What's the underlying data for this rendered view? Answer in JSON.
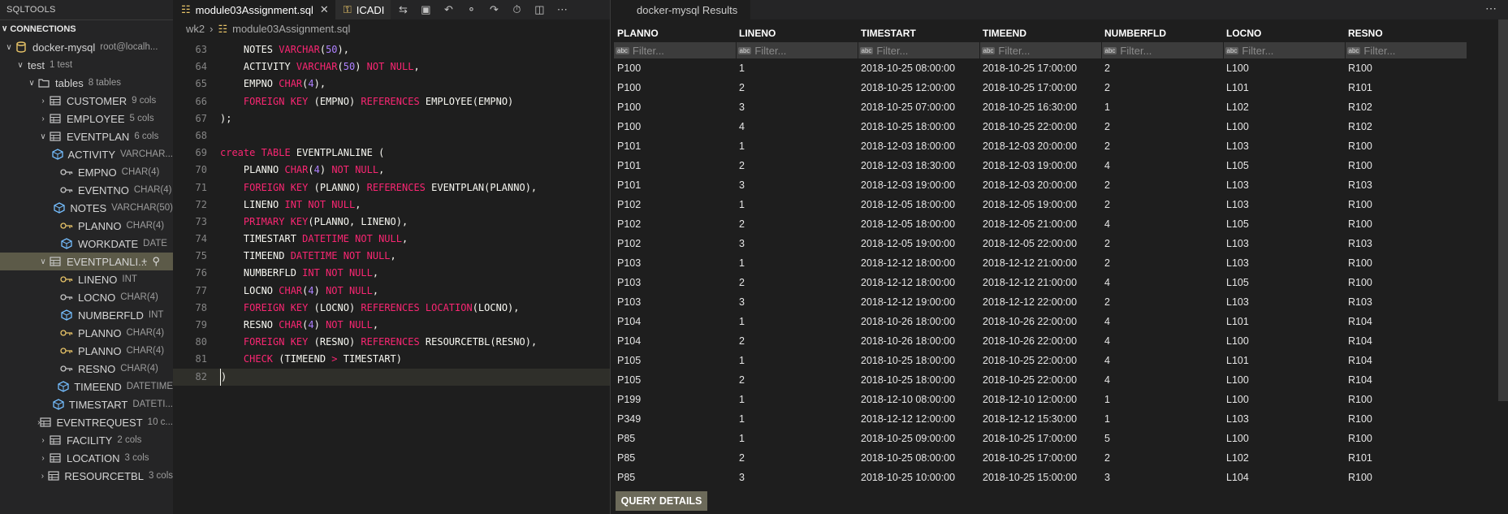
{
  "sidebar": {
    "title": "SQLTOOLS",
    "connections_label": "CONNECTIONS",
    "tree": [
      {
        "label": "docker-mysql",
        "desc": "root@localh...",
        "indent": 0,
        "chev": "∨",
        "icon": "db-icon"
      },
      {
        "label": "test",
        "desc": "1 test",
        "indent": 1,
        "chev": "∨",
        "icon": ""
      },
      {
        "label": "tables",
        "desc": "8 tables",
        "indent": 2,
        "chev": "∨",
        "icon": "folder-icon"
      },
      {
        "label": "CUSTOMER",
        "desc": "9 cols",
        "indent": 3,
        "chev": "›",
        "icon": "table-icon"
      },
      {
        "label": "EMPLOYEE",
        "desc": "5 cols",
        "indent": 3,
        "chev": "›",
        "icon": "table-icon"
      },
      {
        "label": "EVENTPLAN",
        "desc": "6 cols",
        "indent": 3,
        "chev": "∨",
        "icon": "table-icon"
      },
      {
        "label": "ACTIVITY",
        "desc": "VARCHAR...",
        "indent": 4,
        "chev": "",
        "icon": "column-icon"
      },
      {
        "label": "EMPNO",
        "desc": "CHAR(4)",
        "indent": 4,
        "chev": "",
        "icon": "key-icon"
      },
      {
        "label": "EVENTNO",
        "desc": "CHAR(4)",
        "indent": 4,
        "chev": "",
        "icon": "key-icon"
      },
      {
        "label": "NOTES",
        "desc": "VARCHAR(50)",
        "indent": 4,
        "chev": "",
        "icon": "column-icon"
      },
      {
        "label": "PLANNO",
        "desc": "CHAR(4)",
        "indent": 4,
        "chev": "",
        "icon": "pk-icon"
      },
      {
        "label": "WORKDATE",
        "desc": "DATE",
        "indent": 4,
        "chev": "",
        "icon": "column-icon"
      },
      {
        "label": "EVENTPLANLI...",
        "desc": "",
        "indent": 3,
        "chev": "∨",
        "icon": "table-icon",
        "selected": true
      },
      {
        "label": "LINENO",
        "desc": "INT",
        "indent": 4,
        "chev": "",
        "icon": "pk-icon"
      },
      {
        "label": "LOCNO",
        "desc": "CHAR(4)",
        "indent": 4,
        "chev": "",
        "icon": "key-icon"
      },
      {
        "label": "NUMBERFLD",
        "desc": "INT",
        "indent": 4,
        "chev": "",
        "icon": "column-icon"
      },
      {
        "label": "PLANNO",
        "desc": "CHAR(4)",
        "indent": 4,
        "chev": "",
        "icon": "pk-icon"
      },
      {
        "label": "PLANNO",
        "desc": "CHAR(4)",
        "indent": 4,
        "chev": "",
        "icon": "pk-icon"
      },
      {
        "label": "RESNO",
        "desc": "CHAR(4)",
        "indent": 4,
        "chev": "",
        "icon": "key-icon"
      },
      {
        "label": "TIMEEND",
        "desc": "DATETIME",
        "indent": 4,
        "chev": "",
        "icon": "column-icon"
      },
      {
        "label": "TIMESTART",
        "desc": "DATETI...",
        "indent": 4,
        "chev": "",
        "icon": "column-icon"
      },
      {
        "label": "EVENTREQUEST",
        "desc": "10 c...",
        "indent": 3,
        "chev": "›",
        "icon": "table-icon"
      },
      {
        "label": "FACILITY",
        "desc": "2 cols",
        "indent": 3,
        "chev": "›",
        "icon": "table-icon"
      },
      {
        "label": "LOCATION",
        "desc": "3 cols",
        "indent": 3,
        "chev": "›",
        "icon": "table-icon"
      },
      {
        "label": "RESOURCETBL",
        "desc": "3 cols",
        "indent": 3,
        "chev": "›",
        "icon": "table-icon"
      }
    ]
  },
  "editor": {
    "tab_active": "module03Assignment.sql",
    "tab_inactive": "ICADI",
    "breadcrumb": [
      "wk2",
      "module03Assignment.sql"
    ],
    "lines": [
      {
        "n": "63",
        "tokens": [
          [
            "id",
            "    NOTES "
          ],
          [
            "kw",
            "VARCHAR"
          ],
          [
            "id",
            "("
          ],
          [
            "num",
            "50"
          ],
          [
            "id",
            "),"
          ]
        ]
      },
      {
        "n": "64",
        "tokens": [
          [
            "id",
            "    ACTIVITY "
          ],
          [
            "kw",
            "VARCHAR"
          ],
          [
            "id",
            "("
          ],
          [
            "num",
            "50"
          ],
          [
            "id",
            ") "
          ],
          [
            "kw",
            "NOT NULL"
          ],
          [
            "id",
            ","
          ]
        ]
      },
      {
        "n": "65",
        "tokens": [
          [
            "id",
            "    EMPNO "
          ],
          [
            "kw",
            "CHAR"
          ],
          [
            "id",
            "("
          ],
          [
            "num",
            "4"
          ],
          [
            "id",
            "),"
          ]
        ]
      },
      {
        "n": "66",
        "tokens": [
          [
            "id",
            "    "
          ],
          [
            "kw",
            "FOREIGN KEY"
          ],
          [
            "id",
            " (EMPNO) "
          ],
          [
            "kw",
            "REFERENCES"
          ],
          [
            "id",
            " EMPLOYEE(EMPNO)"
          ]
        ]
      },
      {
        "n": "67",
        "tokens": [
          [
            "id",
            ");"
          ]
        ]
      },
      {
        "n": "68",
        "tokens": [
          [
            "id",
            ""
          ]
        ]
      },
      {
        "n": "69",
        "tokens": [
          [
            "kw",
            "create TABLE"
          ],
          [
            "id",
            " EVENTPLANLINE ("
          ]
        ]
      },
      {
        "n": "70",
        "tokens": [
          [
            "id",
            "    PLANNO "
          ],
          [
            "kw",
            "CHAR"
          ],
          [
            "id",
            "("
          ],
          [
            "num",
            "4"
          ],
          [
            "id",
            ") "
          ],
          [
            "kw",
            "NOT NULL"
          ],
          [
            "id",
            ","
          ]
        ]
      },
      {
        "n": "71",
        "tokens": [
          [
            "id",
            "    "
          ],
          [
            "kw",
            "FOREIGN KEY"
          ],
          [
            "id",
            " (PLANNO) "
          ],
          [
            "kw",
            "REFERENCES"
          ],
          [
            "id",
            " EVENTPLAN(PLANNO),"
          ]
        ]
      },
      {
        "n": "72",
        "tokens": [
          [
            "id",
            "    LINENO "
          ],
          [
            "kw",
            "INT NOT NULL"
          ],
          [
            "id",
            ","
          ]
        ]
      },
      {
        "n": "73",
        "tokens": [
          [
            "id",
            "    "
          ],
          [
            "kw",
            "PRIMARY KEY"
          ],
          [
            "id",
            "(PLANNO, LINENO),"
          ]
        ]
      },
      {
        "n": "74",
        "tokens": [
          [
            "id",
            "    TIMESTART "
          ],
          [
            "kw",
            "DATETIME NOT NULL"
          ],
          [
            "id",
            ","
          ]
        ]
      },
      {
        "n": "75",
        "tokens": [
          [
            "id",
            "    TIMEEND "
          ],
          [
            "kw",
            "DATETIME NOT NULL"
          ],
          [
            "id",
            ","
          ]
        ]
      },
      {
        "n": "76",
        "tokens": [
          [
            "id",
            "    NUMBERFLD "
          ],
          [
            "kw",
            "INT NOT NULL"
          ],
          [
            "id",
            ","
          ]
        ]
      },
      {
        "n": "77",
        "tokens": [
          [
            "id",
            "    LOCNO "
          ],
          [
            "kw",
            "CHAR"
          ],
          [
            "id",
            "("
          ],
          [
            "num",
            "4"
          ],
          [
            "id",
            ") "
          ],
          [
            "kw",
            "NOT NULL"
          ],
          [
            "id",
            ","
          ]
        ]
      },
      {
        "n": "78",
        "tokens": [
          [
            "id",
            "    "
          ],
          [
            "kw",
            "FOREIGN KEY"
          ],
          [
            "id",
            " (LOCNO) "
          ],
          [
            "kw",
            "REFERENCES"
          ],
          [
            "id",
            " "
          ],
          [
            "kw",
            "LOCATION"
          ],
          [
            "id",
            "(LOCNO),"
          ]
        ]
      },
      {
        "n": "79",
        "tokens": [
          [
            "id",
            "    RESNO "
          ],
          [
            "kw",
            "CHAR"
          ],
          [
            "id",
            "("
          ],
          [
            "num",
            "4"
          ],
          [
            "id",
            ") "
          ],
          [
            "kw",
            "NOT NULL"
          ],
          [
            "id",
            ","
          ]
        ]
      },
      {
        "n": "80",
        "tokens": [
          [
            "id",
            "    "
          ],
          [
            "kw",
            "FOREIGN KEY"
          ],
          [
            "id",
            " (RESNO) "
          ],
          [
            "kw",
            "REFERENCES"
          ],
          [
            "id",
            " RESOURCETBL(RESNO),"
          ]
        ]
      },
      {
        "n": "81",
        "tokens": [
          [
            "id",
            "    "
          ],
          [
            "kw",
            "CHECK"
          ],
          [
            "id",
            " (TIMEEND "
          ],
          [
            "kw",
            ">"
          ],
          [
            "id",
            " TIMESTART)"
          ]
        ]
      },
      {
        "n": "82",
        "tokens": [
          [
            "id",
            ")"
          ]
        ],
        "highlight": true
      }
    ]
  },
  "results": {
    "tab_label": "docker-mysql Results",
    "filter_placeholder": "Filter...",
    "columns": [
      "PLANNO",
      "LINENO",
      "TIMESTART",
      "TIMEEND",
      "NUMBERFLD",
      "LOCNO",
      "RESNO"
    ],
    "rows": [
      [
        "P100",
        "1",
        "2018-10-25 08:00:00",
        "2018-10-25 17:00:00",
        "2",
        "L100",
        "R100"
      ],
      [
        "P100",
        "2",
        "2018-10-25 12:00:00",
        "2018-10-25 17:00:00",
        "2",
        "L101",
        "R101"
      ],
      [
        "P100",
        "3",
        "2018-10-25 07:00:00",
        "2018-10-25 16:30:00",
        "1",
        "L102",
        "R102"
      ],
      [
        "P100",
        "4",
        "2018-10-25 18:00:00",
        "2018-10-25 22:00:00",
        "2",
        "L100",
        "R102"
      ],
      [
        "P101",
        "1",
        "2018-12-03 18:00:00",
        "2018-12-03 20:00:00",
        "2",
        "L103",
        "R100"
      ],
      [
        "P101",
        "2",
        "2018-12-03 18:30:00",
        "2018-12-03 19:00:00",
        "4",
        "L105",
        "R100"
      ],
      [
        "P101",
        "3",
        "2018-12-03 19:00:00",
        "2018-12-03 20:00:00",
        "2",
        "L103",
        "R103"
      ],
      [
        "P102",
        "1",
        "2018-12-05 18:00:00",
        "2018-12-05 19:00:00",
        "2",
        "L103",
        "R100"
      ],
      [
        "P102",
        "2",
        "2018-12-05 18:00:00",
        "2018-12-05 21:00:00",
        "4",
        "L105",
        "R100"
      ],
      [
        "P102",
        "3",
        "2018-12-05 19:00:00",
        "2018-12-05 22:00:00",
        "2",
        "L103",
        "R103"
      ],
      [
        "P103",
        "1",
        "2018-12-12 18:00:00",
        "2018-12-12 21:00:00",
        "2",
        "L103",
        "R100"
      ],
      [
        "P103",
        "2",
        "2018-12-12 18:00:00",
        "2018-12-12 21:00:00",
        "4",
        "L105",
        "R100"
      ],
      [
        "P103",
        "3",
        "2018-12-12 19:00:00",
        "2018-12-12 22:00:00",
        "2",
        "L103",
        "R103"
      ],
      [
        "P104",
        "1",
        "2018-10-26 18:00:00",
        "2018-10-26 22:00:00",
        "4",
        "L101",
        "R104"
      ],
      [
        "P104",
        "2",
        "2018-10-26 18:00:00",
        "2018-10-26 22:00:00",
        "4",
        "L100",
        "R104"
      ],
      [
        "P105",
        "1",
        "2018-10-25 18:00:00",
        "2018-10-25 22:00:00",
        "4",
        "L101",
        "R104"
      ],
      [
        "P105",
        "2",
        "2018-10-25 18:00:00",
        "2018-10-25 22:00:00",
        "4",
        "L100",
        "R104"
      ],
      [
        "P199",
        "1",
        "2018-12-10 08:00:00",
        "2018-12-10 12:00:00",
        "1",
        "L100",
        "R100"
      ],
      [
        "P349",
        "1",
        "2018-12-12 12:00:00",
        "2018-12-12 15:30:00",
        "1",
        "L103",
        "R100"
      ],
      [
        "P85",
        "1",
        "2018-10-25 09:00:00",
        "2018-10-25 17:00:00",
        "5",
        "L100",
        "R100"
      ],
      [
        "P85",
        "2",
        "2018-10-25 08:00:00",
        "2018-10-25 17:00:00",
        "2",
        "L102",
        "R101"
      ],
      [
        "P85",
        "3",
        "2018-10-25 10:00:00",
        "2018-10-25 15:00:00",
        "3",
        "L104",
        "R100"
      ]
    ],
    "query_details_label": "QUERY DETAILS"
  }
}
